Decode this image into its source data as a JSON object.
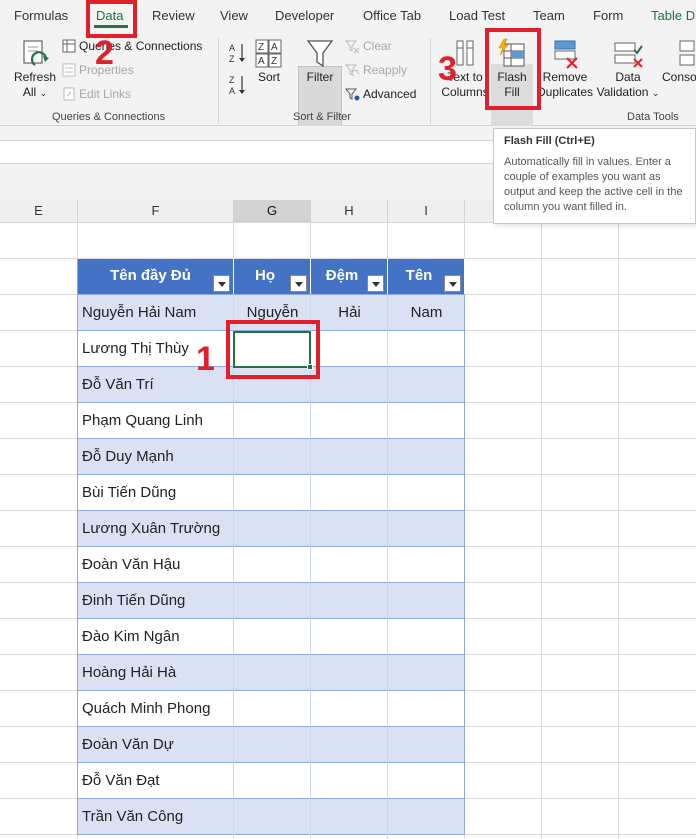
{
  "ribbon": {
    "tabs": [
      {
        "label": "Formulas",
        "active": false
      },
      {
        "label": "Data",
        "active": true
      },
      {
        "label": "Review",
        "active": false
      },
      {
        "label": "View",
        "active": false
      },
      {
        "label": "Developer",
        "active": false
      },
      {
        "label": "Office Tab",
        "active": false
      },
      {
        "label": "Load Test",
        "active": false
      },
      {
        "label": "Team",
        "active": false
      },
      {
        "label": "Form",
        "active": false
      },
      {
        "label": "Table D",
        "active": false
      }
    ],
    "queries": {
      "refresh_all": "Refresh",
      "refresh_all_2": "All",
      "queries_connections": "Queries & Connections",
      "properties": "Properties",
      "edit_links": "Edit Links",
      "group_label": "Queries & Connections"
    },
    "sort_filter": {
      "sort": "Sort",
      "filter": "Filter",
      "clear": "Clear",
      "reapply": "Reapply",
      "advanced": "Advanced",
      "group_label": "Sort & Filter"
    },
    "data_tools": {
      "text_to_columns_1": "Text to",
      "text_to_columns_2": "Columns",
      "flash_fill_1": "Flash",
      "flash_fill_2": "Fill",
      "remove_duplicates_1": "Remove",
      "remove_duplicates_2": "Duplicates",
      "data_validation_1": "Data",
      "data_validation_2": "Validation",
      "consolidate": "Conso",
      "group_label": "Data Tools"
    }
  },
  "tooltip": {
    "title": "Flash Fill (Ctrl+E)",
    "body": "Automatically fill in values. Enter a couple of examples you want as output and keep the active cell in the column you want filled in."
  },
  "columns": [
    "E",
    "F",
    "G",
    "H",
    "I"
  ],
  "table": {
    "headers": [
      "Tên đầy Đủ",
      "Họ",
      "Đệm",
      "Tên"
    ],
    "rows": [
      [
        "Nguyễn Hải Nam",
        "Nguyễn",
        "Hải",
        "Nam"
      ],
      [
        "Lương Thị Thùy",
        "",
        "",
        ""
      ],
      [
        "Đỗ Văn Trí",
        "",
        "",
        ""
      ],
      [
        "Phạm Quang Linh",
        "",
        "",
        ""
      ],
      [
        "Đỗ Duy Mạnh",
        "",
        "",
        ""
      ],
      [
        "Bùi Tiến Dũng",
        "",
        "",
        ""
      ],
      [
        "Lương Xuân Trường",
        "",
        "",
        ""
      ],
      [
        "Đoàn Văn Hậu",
        "",
        "",
        ""
      ],
      [
        "Đinh Tiến Dũng",
        "",
        "",
        ""
      ],
      [
        "Đào Kim Ngân",
        "",
        "",
        ""
      ],
      [
        "Hoàng Hải Hà",
        "",
        "",
        ""
      ],
      [
        "Quách Minh Phong",
        "",
        "",
        ""
      ],
      [
        "Đoàn Văn Dự",
        "",
        "",
        ""
      ],
      [
        "Đỗ Văn Đạt",
        "",
        "",
        ""
      ],
      [
        "Trần Văn Công",
        "",
        "",
        ""
      ]
    ]
  },
  "annotations": {
    "step1": "1",
    "step2": "2",
    "step3": "3"
  },
  "colors": {
    "accent": "#217346",
    "table_header": "#4472c4",
    "band": "#d9e1f2",
    "annotation": "#e0212b"
  }
}
